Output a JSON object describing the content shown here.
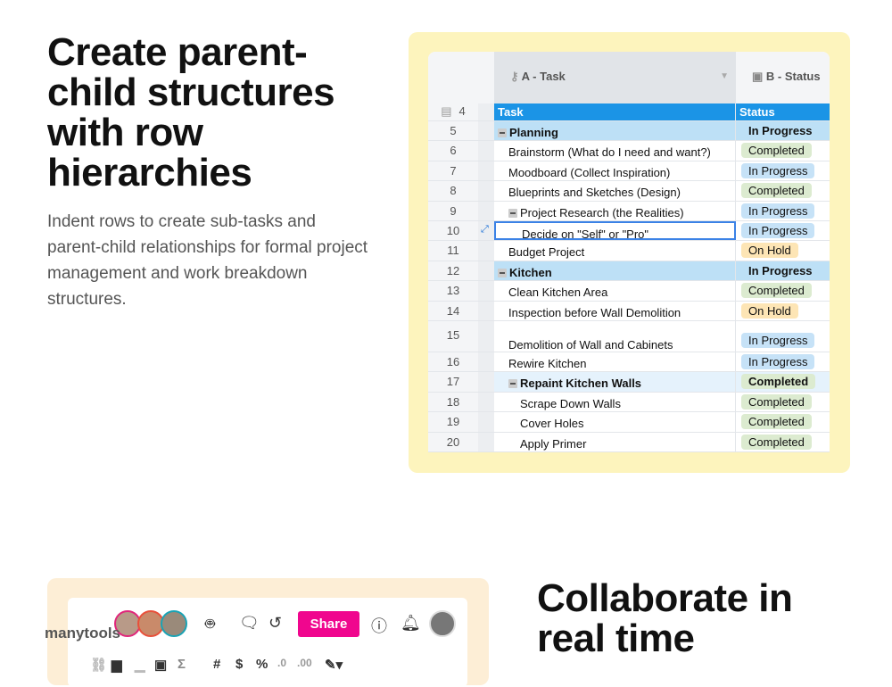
{
  "section1": {
    "title": "Create parent-child structures with row hierarchies",
    "body": "Indent rows to create sub-tasks and parent-child relationships for formal project management and work breakdown structures."
  },
  "section2": {
    "title": "Collaborate in real time"
  },
  "sheet": {
    "col_a": "A - Task",
    "col_b": "B - Status",
    "header_row": {
      "num": "4",
      "task": "Task",
      "status": "Status"
    },
    "status_colors": {
      "Completed": "#dcebd0",
      "In Progress": "#c6e2f7",
      "On Hold": "#fde5b5"
    },
    "rows": [
      {
        "num": "5",
        "task": "Planning",
        "status": "In Progress",
        "level": 0,
        "group": true
      },
      {
        "num": "6",
        "task": "Brainstorm (What do I need and want?)",
        "status": "Completed",
        "level": 1
      },
      {
        "num": "7",
        "task": "Moodboard (Collect Inspiration)",
        "status": "In Progress",
        "level": 1
      },
      {
        "num": "8",
        "task": "Blueprints and Sketches (Design)",
        "status": "Completed",
        "level": 1
      },
      {
        "num": "9",
        "task": "Project Research (the Realities)",
        "status": "In Progress",
        "level": 1,
        "collapsible": true
      },
      {
        "num": "10",
        "task": "Decide on \"Self\" or \"Pro\"",
        "status": "In Progress",
        "level": 2,
        "selected": true
      },
      {
        "num": "11",
        "task": "Budget Project",
        "status": "On Hold",
        "level": 1
      },
      {
        "num": "12",
        "task": "Kitchen",
        "status": "In Progress",
        "level": 0,
        "group": true
      },
      {
        "num": "13",
        "task": "Clean Kitchen Area",
        "status": "Completed",
        "level": 1
      },
      {
        "num": "14",
        "task": "Inspection before Wall Demolition",
        "status": "On Hold",
        "level": 1
      },
      {
        "num": "15",
        "task": "Demolition of Wall and Cabinets",
        "status": "In Progress",
        "level": 1,
        "tall": true
      },
      {
        "num": "16",
        "task": "Rewire Kitchen",
        "status": "In Progress",
        "level": 1
      },
      {
        "num": "17",
        "task": "Repaint Kitchen Walls",
        "status": "Completed",
        "level": 1,
        "subgroup": true
      },
      {
        "num": "18",
        "task": "Scrape Down Walls",
        "status": "Completed",
        "level": 2
      },
      {
        "num": "19",
        "task": "Cover Holes",
        "status": "Completed",
        "level": 2
      },
      {
        "num": "20",
        "task": "Apply Primer",
        "status": "Completed",
        "level": 2
      }
    ]
  },
  "collab": {
    "share_label": "Share",
    "brand": "manytools",
    "share_color": "#f0068e"
  }
}
